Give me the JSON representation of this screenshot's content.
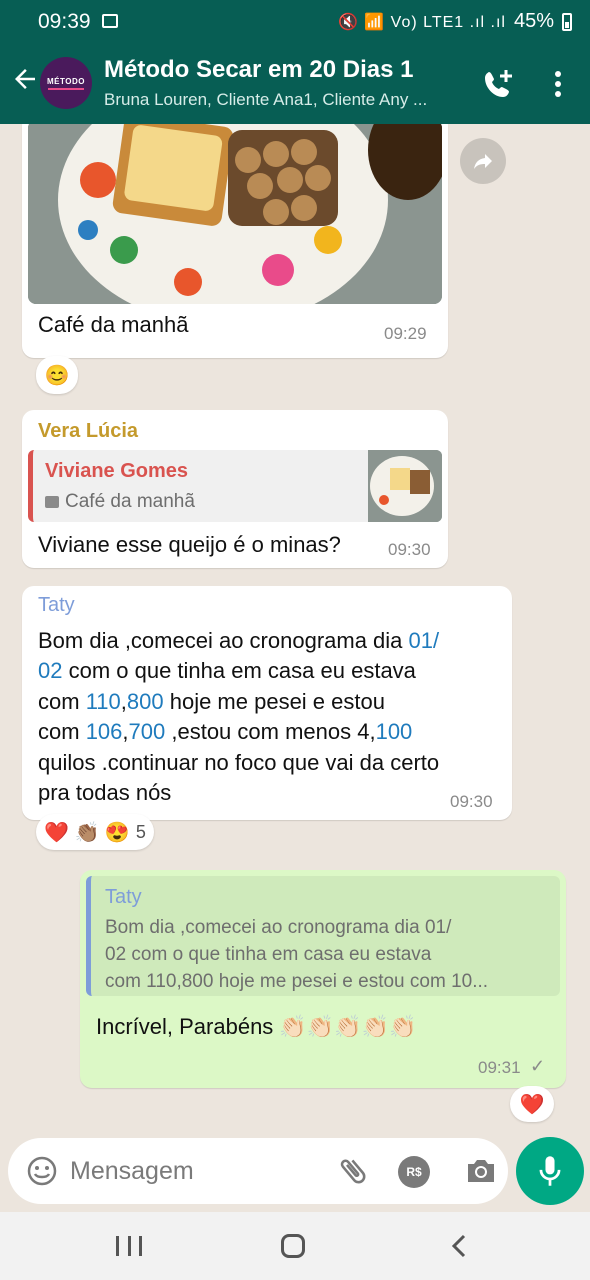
{
  "status_bar": {
    "time": "09:39",
    "network_glyphs": "🔇 📶 Vo) LTE1 .ıl .ıl",
    "battery": "45%"
  },
  "header": {
    "title": "Método Secar em 20 Dias 1",
    "subtitle": "Bruna Louren, Cliente Ana1, Cliente Any ...",
    "avatar_logo_text": "MÉTODO"
  },
  "messages": {
    "image_message": {
      "caption": "Café da manhã",
      "time": "09:29",
      "reaction": "😊"
    },
    "vera_message": {
      "sender": "Vera Lúcia",
      "quoted_name": "Viviane Gomes",
      "quoted_text": "Café da manhã",
      "text": "Viviane esse queijo é o minas?",
      "time": "09:30"
    },
    "taty_message": {
      "sender": "Taty",
      "line1_a": "Bom dia ,comecei ao cronograma dia ",
      "line1_b": "01/",
      "line2_a": "02",
      "line2_b": " com o que tinha em casa  eu estava",
      "line3_a": "com ",
      "line3_b": "110",
      "line3_c": ",",
      "line3_d": "800",
      "line3_e": " hoje me pesei e estou",
      "line4_a": "com ",
      "line4_b": "106",
      "line4_c": ",",
      "line4_d": "700",
      "line4_e": "  ,estou com menos 4,",
      "line4_f": "100",
      "line5": "quilos .continuar no foco que vai da certo",
      "line6": "pra todas nós",
      "time": "09:30",
      "reactions": "❤️ 👏🏽 😍",
      "reaction_count": "5"
    },
    "my_message": {
      "quoted_name": "Taty",
      "quoted_line1": "Bom dia ,comecei ao cronograma dia 01/",
      "quoted_line2": "02 com o que tinha em casa  eu estava",
      "quoted_line3": "com 110,800 hoje me pesei e estou com 10...",
      "text": "Incrível, Parabéns 👏🏻👏🏻👏🏻👏🏻👏🏻",
      "time": "09:31",
      "tick": "✓",
      "reaction": "❤️"
    }
  },
  "input": {
    "placeholder": "Mensagem",
    "pay_label": "R$"
  },
  "colors": {
    "header": "#075e54",
    "incoming_bubble": "#ffffff",
    "outgoing_bubble": "#dcf8c6",
    "chat_background": "#ece5dd",
    "link_number": "#1f7bbd",
    "sender_vera": "#c49a2c",
    "sender_taty": "#7e9dd9",
    "quoted_viviane": "#d9534f",
    "mic_button": "#00a884"
  }
}
